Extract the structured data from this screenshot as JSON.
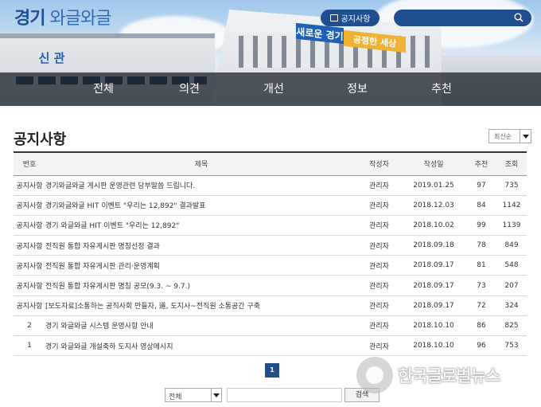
{
  "header": {
    "logo_bold": "경기",
    "logo_light": "와글와글",
    "notice_button": "공지사항",
    "sign_blue": "새로운 경기",
    "sign_yellow": "공정한 세상",
    "sign_left": "신 관"
  },
  "nav": {
    "items": [
      {
        "label": "전체"
      },
      {
        "label": "의견"
      },
      {
        "label": "개선"
      },
      {
        "label": "정보"
      },
      {
        "label": "추천"
      }
    ]
  },
  "page": {
    "title": "공지사항",
    "sort_selected": "최신순"
  },
  "table": {
    "headers": {
      "no": "번호",
      "title": "제목",
      "author": "작성자",
      "date": "작성일",
      "rec": "추천",
      "views": "조회"
    },
    "rows": [
      {
        "no": "공지사항",
        "title": "경기와글와글 게시판 운영관련 당부말씀 드립니다.",
        "author": "관리자",
        "date": "2019.01.25",
        "rec": "97",
        "views": "735"
      },
      {
        "no": "공지사항",
        "title": "경기와글와글 HIT 이벤트 \"우리는 12,892\" 결과발표",
        "author": "관리자",
        "date": "2018.12.03",
        "rec": "84",
        "views": "1142"
      },
      {
        "no": "공지사항",
        "title": "경기 와글와글 HIT 이벤트 \"우리는 12,892\"",
        "author": "관리자",
        "date": "2018.10.02",
        "rec": "99",
        "views": "1139"
      },
      {
        "no": "공지사항",
        "title": "전직원 통합 자유게시판 명칭선정 결과",
        "author": "관리자",
        "date": "2018.09.18",
        "rec": "78",
        "views": "849"
      },
      {
        "no": "공지사항",
        "title": "전직원 통합 자유게시판 관리·운영계획",
        "author": "관리자",
        "date": "2018.09.17",
        "rec": "81",
        "views": "548"
      },
      {
        "no": "공지사항",
        "title": "전직원 통합 자유게시판 명칭 공모(9.3. ~ 9.7.)",
        "author": "관리자",
        "date": "2018.09.17",
        "rec": "73",
        "views": "207"
      },
      {
        "no": "공지사항",
        "title": "[보도자료]소통하는 공직사회 만들자, 道, 도지사~전직원 소통공간 구축",
        "author": "관리자",
        "date": "2018.09.17",
        "rec": "72",
        "views": "324"
      },
      {
        "no": "2",
        "title": "경기 와글와글 시스템 운영사항 안내",
        "author": "관리자",
        "date": "2018.10.10",
        "rec": "86",
        "views": "825"
      },
      {
        "no": "1",
        "title": "경기 와글와글 개설축하 도지사 영상메시지",
        "author": "관리자",
        "date": "2018.10.10",
        "rec": "96",
        "views": "753"
      }
    ]
  },
  "pagination": {
    "current": "1"
  },
  "search": {
    "scope_selected": "전체",
    "keyword_value": "",
    "button_label": "검색"
  },
  "watermark": {
    "text": "한국글로벌뉴스"
  },
  "colors": {
    "accent": "#1f4f8e",
    "logo": "#1d4f95",
    "nav_overlay": "#141a22"
  }
}
